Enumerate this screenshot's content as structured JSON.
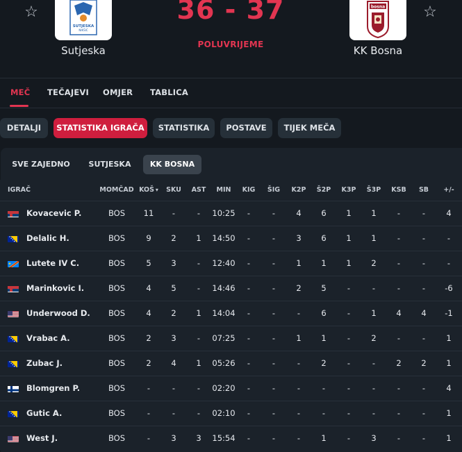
{
  "header": {
    "home_team": "Sutjeska",
    "away_team": "KK Bosna",
    "home_logo_text": "SUTJESKA",
    "home_logo_sub": "NIKŠIĆ",
    "away_logo_text": "bosna",
    "score": "36 - 37",
    "status": "POLUVRIJEME",
    "favorite_icon": "star-outline-icon"
  },
  "main_tabs": [
    "MEČ",
    "TEČAJEVI",
    "OMJER",
    "TABLICA"
  ],
  "pills": [
    "DETALJI",
    "STATISTIKA IGRAČA",
    "STATISTIKA",
    "POSTAVE",
    "TIJEK MEČA"
  ],
  "sub_tabs": [
    "SVE ZAJEDNO",
    "SUTJESKA",
    "KK BOSNA"
  ],
  "table": {
    "headers": [
      "IGRAČ",
      "MOMČAD",
      "KOŠ",
      "SKU",
      "AST",
      "MIN",
      "KIG",
      "ŠIG",
      "K2P",
      "Š2P",
      "K3P",
      "Š3P",
      "KSB",
      "SB",
      "+/-"
    ],
    "sort_indicator": "▾",
    "rows": [
      {
        "flag": "serbia",
        "name": "Kovacevic P.",
        "team": "BOS",
        "pts": "11",
        "reb": "-",
        "ast": "-",
        "min": "10:25",
        "kig": "-",
        "sig": "-",
        "k2p": "4",
        "s2p": "6",
        "k3p": "1",
        "s3p": "1",
        "ksb": "-",
        "sb": "-",
        "pm": "4"
      },
      {
        "flag": "bosnia",
        "name": "Delalic H.",
        "team": "BOS",
        "pts": "9",
        "reb": "2",
        "ast": "1",
        "min": "14:50",
        "kig": "-",
        "sig": "-",
        "k2p": "3",
        "s2p": "6",
        "k3p": "1",
        "s3p": "1",
        "ksb": "-",
        "sb": "-",
        "pm": "-"
      },
      {
        "flag": "drcongo",
        "name": "Lutete IV C.",
        "team": "BOS",
        "pts": "5",
        "reb": "3",
        "ast": "-",
        "min": "12:40",
        "kig": "-",
        "sig": "-",
        "k2p": "1",
        "s2p": "1",
        "k3p": "1",
        "s3p": "2",
        "ksb": "-",
        "sb": "-",
        "pm": "-"
      },
      {
        "flag": "serbia",
        "name": "Marinkovic I.",
        "team": "BOS",
        "pts": "4",
        "reb": "5",
        "ast": "-",
        "min": "14:46",
        "kig": "-",
        "sig": "-",
        "k2p": "2",
        "s2p": "5",
        "k3p": "-",
        "s3p": "-",
        "ksb": "-",
        "sb": "-",
        "pm": "-6"
      },
      {
        "flag": "usa",
        "name": "Underwood D.",
        "team": "BOS",
        "pts": "4",
        "reb": "2",
        "ast": "1",
        "min": "14:04",
        "kig": "-",
        "sig": "-",
        "k2p": "-",
        "s2p": "6",
        "k3p": "-",
        "s3p": "1",
        "ksb": "4",
        "sb": "4",
        "pm": "-1"
      },
      {
        "flag": "bosnia",
        "name": "Vrabac A.",
        "team": "BOS",
        "pts": "2",
        "reb": "3",
        "ast": "-",
        "min": "07:25",
        "kig": "-",
        "sig": "-",
        "k2p": "1",
        "s2p": "1",
        "k3p": "-",
        "s3p": "2",
        "ksb": "-",
        "sb": "-",
        "pm": "1"
      },
      {
        "flag": "bosnia",
        "name": "Zubac J.",
        "team": "BOS",
        "pts": "2",
        "reb": "4",
        "ast": "1",
        "min": "05:26",
        "kig": "-",
        "sig": "-",
        "k2p": "-",
        "s2p": "2",
        "k3p": "-",
        "s3p": "-",
        "ksb": "2",
        "sb": "2",
        "pm": "1"
      },
      {
        "flag": "finland",
        "name": "Blomgren P.",
        "team": "BOS",
        "pts": "-",
        "reb": "-",
        "ast": "-",
        "min": "02:20",
        "kig": "-",
        "sig": "-",
        "k2p": "-",
        "s2p": "-",
        "k3p": "-",
        "s3p": "-",
        "ksb": "-",
        "sb": "-",
        "pm": "4"
      },
      {
        "flag": "bosnia",
        "name": "Gutic A.",
        "team": "BOS",
        "pts": "-",
        "reb": "-",
        "ast": "-",
        "min": "02:10",
        "kig": "-",
        "sig": "-",
        "k2p": "-",
        "s2p": "-",
        "k3p": "-",
        "s3p": "-",
        "ksb": "-",
        "sb": "-",
        "pm": "1"
      },
      {
        "flag": "usa",
        "name": "West J.",
        "team": "BOS",
        "pts": "-",
        "reb": "3",
        "ast": "3",
        "min": "15:54",
        "kig": "-",
        "sig": "-",
        "k2p": "-",
        "s2p": "1",
        "k3p": "-",
        "s3p": "3",
        "ksb": "-",
        "sb": "-",
        "pm": "1"
      }
    ]
  },
  "colors": {
    "accent": "#e23551",
    "pill_active": "#cf1e3e",
    "background": "#14191f",
    "panel": "#1b222a"
  }
}
